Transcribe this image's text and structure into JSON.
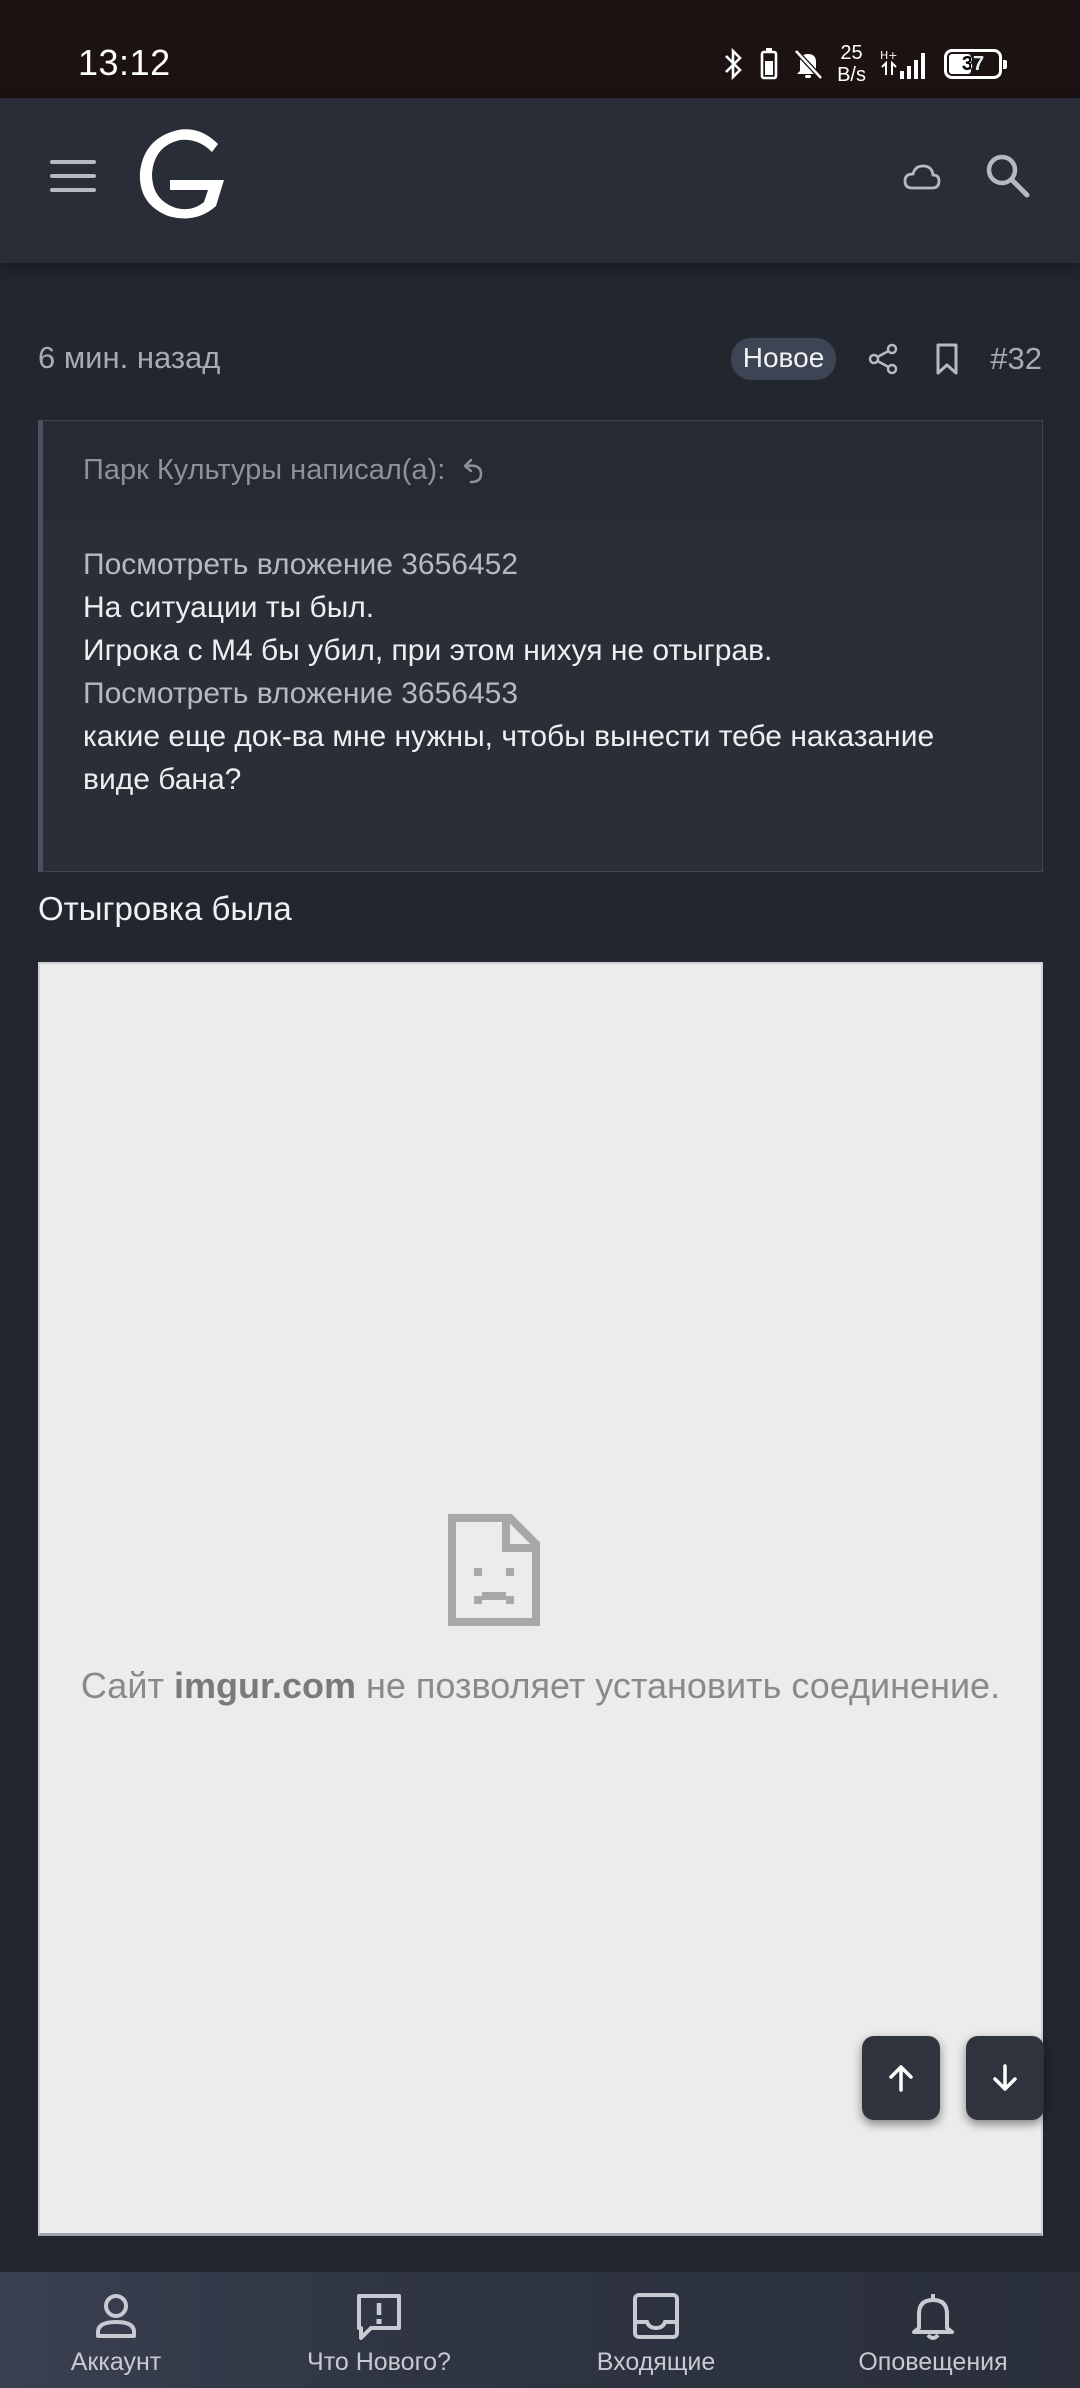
{
  "status_bar": {
    "time": "13:12",
    "net_speed_value": "25",
    "net_speed_unit": "B/s",
    "battery": "37",
    "icons": [
      "bluetooth-icon",
      "battery-saver-icon",
      "mute-icon",
      "signal-icon"
    ]
  },
  "header": {
    "icons": [
      "menu-icon",
      "site-logo",
      "cloud-icon",
      "search-icon"
    ]
  },
  "post": {
    "time": "6 мин. назад",
    "badge": "Новое",
    "number": "#32",
    "quote": {
      "author_line": "Парк Культуры написал(а):",
      "link1": "Посмотреть вложение 3656452",
      "line1": "На ситуации ты был.",
      "line2": "Игрока с М4 бы убил, при этом нихуя не отыграв.",
      "link2": "Посмотреть вложение 3656453",
      "line3": "какие еще док-ва мне нужны, чтобы вынести тебе наказание виде бана?"
    },
    "reply": "Отыгровка была",
    "embed": {
      "error_prefix": "Сайт",
      "error_domain": "imgur.com",
      "error_suffix": "не позволяет установить соединение."
    }
  },
  "bottom_nav": [
    {
      "label": "Аккаунт",
      "icon": "account-icon"
    },
    {
      "label": "Что Нового?",
      "icon": "whats-new-icon"
    },
    {
      "label": "Входящие",
      "icon": "inbox-icon"
    },
    {
      "label": "Оповещения",
      "icon": "bell-icon"
    }
  ],
  "colors": {
    "background": "#22262f",
    "header": "#282d38",
    "status_bar": "#1c1212",
    "link": "#b3bac6",
    "embed_bg": "#ececec"
  }
}
